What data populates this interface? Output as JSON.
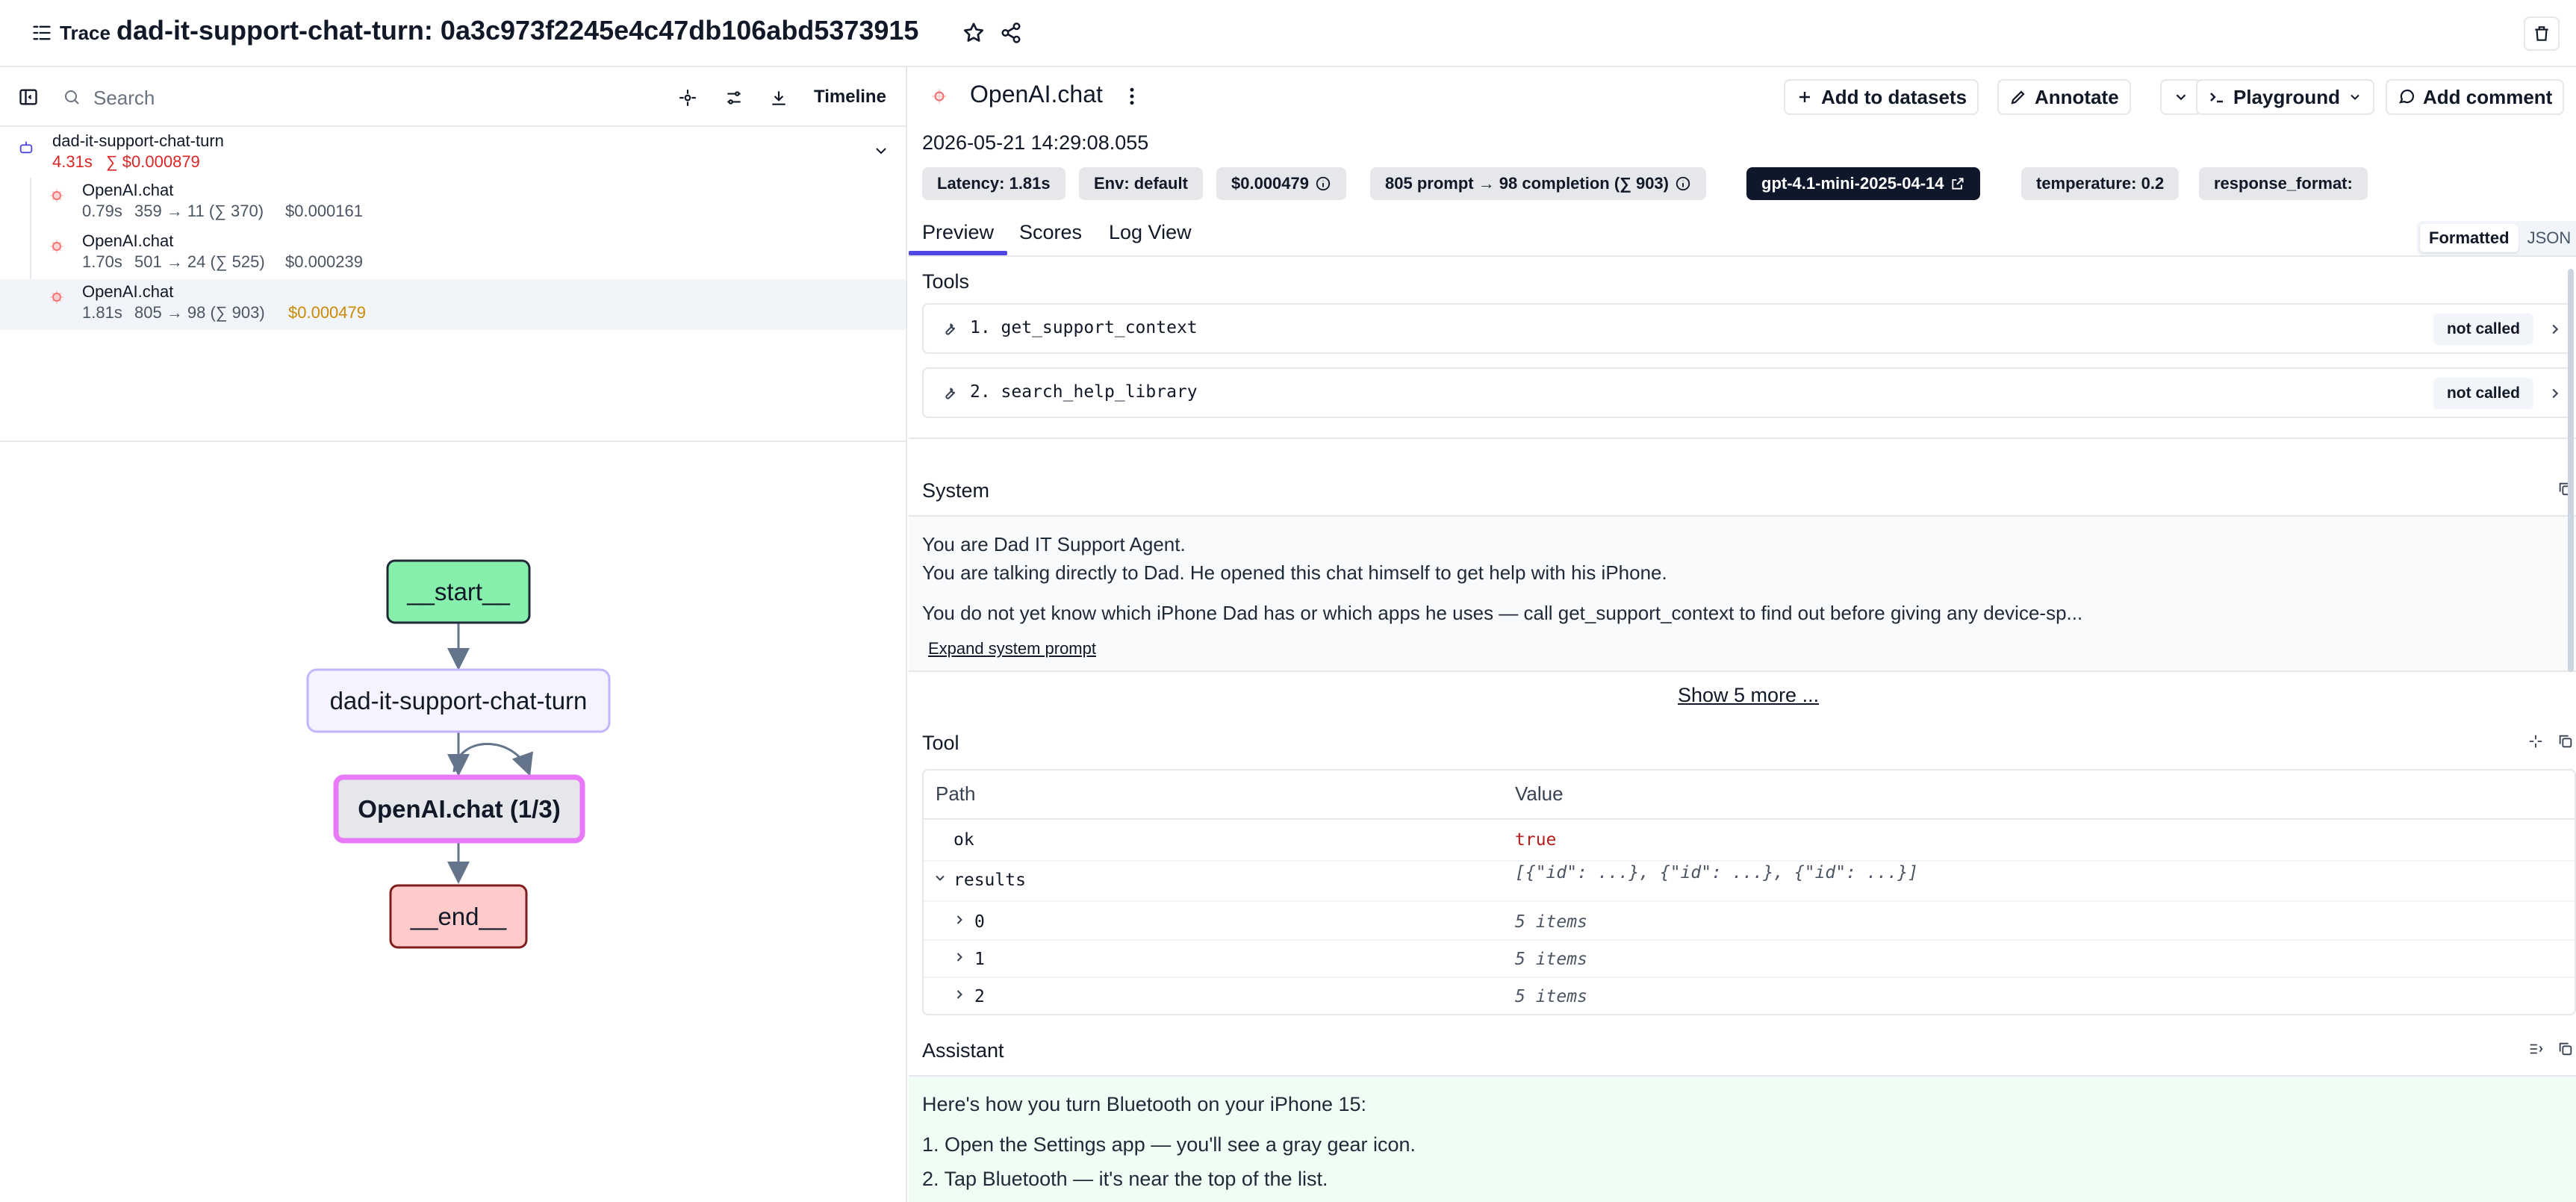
{
  "header": {
    "trace_label": "Trace",
    "title": "dad-it-support-chat-turn: 0a3c973f2245e4c47db106abd5373915"
  },
  "left_toolbar": {
    "search_placeholder": "Search",
    "timeline_label": "Timeline"
  },
  "tree": {
    "root": {
      "name": "dad-it-support-chat-turn",
      "latency": "4.31s",
      "cost": "∑ $0.000879"
    },
    "children": [
      {
        "name": "OpenAI.chat",
        "latency": "0.79s",
        "tokens": "359 → 11 (∑ 370)",
        "cost": "$0.000161"
      },
      {
        "name": "OpenAI.chat",
        "latency": "1.70s",
        "tokens": "501 → 24 (∑ 525)",
        "cost": "$0.000239"
      },
      {
        "name": "OpenAI.chat",
        "latency": "1.81s",
        "tokens": "805 → 98 (∑ 903)",
        "cost": "$0.000479"
      }
    ]
  },
  "graph": {
    "start": "__start__",
    "agent": "dad-it-support-chat-turn",
    "llm": "OpenAI.chat (1/3)",
    "end": "__end__"
  },
  "observation": {
    "title": "OpenAI.chat",
    "buttons": {
      "add_to_datasets": "Add to datasets",
      "annotate": "Annotate",
      "playground": "Playground",
      "add_comment": "Add comment"
    },
    "timestamp": "2026-05-21 14:29:08.055",
    "badges": {
      "latency": "Latency: 1.81s",
      "env": "Env: default",
      "cost": "$0.000479",
      "tokens": "805 prompt → 98 completion (∑ 903)",
      "model": "gpt-4.1-mini-2025-04-14",
      "temperature": "temperature: 0.2",
      "response_format": "response_format:"
    },
    "tabs": [
      "Preview",
      "Scores",
      "Log View"
    ],
    "view_toggle": [
      "Formatted",
      "JSON"
    ]
  },
  "tools_section": {
    "title": "Tools",
    "items": [
      {
        "name": "1. get_support_context",
        "status": "not called"
      },
      {
        "name": "2. search_help_library",
        "status": "not called"
      }
    ]
  },
  "system_section": {
    "title": "System",
    "lines": [
      "You are Dad IT Support Agent.",
      "You are talking directly to Dad. He opened this chat himself to get help with his iPhone.",
      "You do not yet know which iPhone Dad has or which apps he uses — call get_support_context to find out before giving any device-sp..."
    ],
    "expand_label": "Expand system prompt"
  },
  "show_more": "Show 5 more ...",
  "tool_section": {
    "title": "Tool",
    "columns": [
      "Path",
      "Value"
    ],
    "rows": [
      {
        "path": "ok",
        "value": "true"
      },
      {
        "path": "results",
        "value": "[{\"id\": ...}, {\"id\": ...}, {\"id\": ...}]"
      },
      {
        "path": "0",
        "value": "5 items"
      },
      {
        "path": "1",
        "value": "5 items"
      },
      {
        "path": "2",
        "value": "5 items"
      }
    ]
  },
  "assistant_section": {
    "title": "Assistant",
    "lines": [
      "Here's how you turn Bluetooth on your iPhone 15:",
      "1. Open the Settings app — you'll see a gray gear icon.",
      "2. Tap Bluetooth — it's near the top of the list."
    ]
  },
  "colors": {
    "accent": "#4f46e5",
    "start_node": "#86efac",
    "agent_node": "#f5f3ff",
    "llm_node_border": "#e879f9",
    "end_node": "#fecaca",
    "cost_red": "#dc2626",
    "cost_amber": "#ca8a04"
  }
}
